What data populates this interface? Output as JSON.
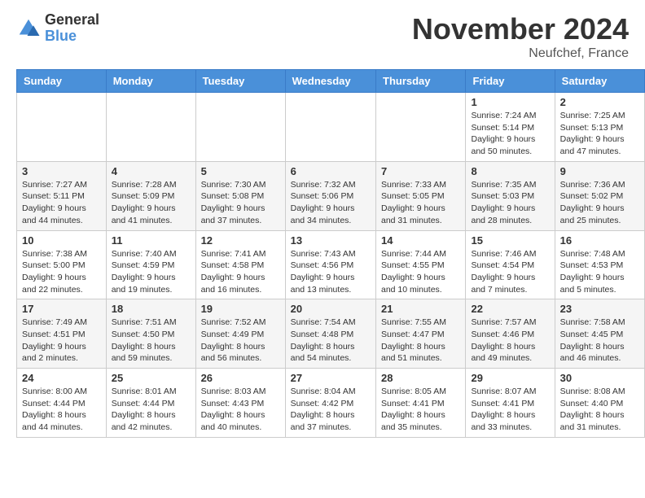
{
  "header": {
    "logo_general": "General",
    "logo_blue": "Blue",
    "month_title": "November 2024",
    "location": "Neufchef, France"
  },
  "days_of_week": [
    "Sunday",
    "Monday",
    "Tuesday",
    "Wednesday",
    "Thursday",
    "Friday",
    "Saturday"
  ],
  "weeks": [
    {
      "days": [
        {
          "num": "",
          "info": ""
        },
        {
          "num": "",
          "info": ""
        },
        {
          "num": "",
          "info": ""
        },
        {
          "num": "",
          "info": ""
        },
        {
          "num": "",
          "info": ""
        },
        {
          "num": "1",
          "info": "Sunrise: 7:24 AM\nSunset: 5:14 PM\nDaylight: 9 hours\nand 50 minutes."
        },
        {
          "num": "2",
          "info": "Sunrise: 7:25 AM\nSunset: 5:13 PM\nDaylight: 9 hours\nand 47 minutes."
        }
      ]
    },
    {
      "days": [
        {
          "num": "3",
          "info": "Sunrise: 7:27 AM\nSunset: 5:11 PM\nDaylight: 9 hours\nand 44 minutes."
        },
        {
          "num": "4",
          "info": "Sunrise: 7:28 AM\nSunset: 5:09 PM\nDaylight: 9 hours\nand 41 minutes."
        },
        {
          "num": "5",
          "info": "Sunrise: 7:30 AM\nSunset: 5:08 PM\nDaylight: 9 hours\nand 37 minutes."
        },
        {
          "num": "6",
          "info": "Sunrise: 7:32 AM\nSunset: 5:06 PM\nDaylight: 9 hours\nand 34 minutes."
        },
        {
          "num": "7",
          "info": "Sunrise: 7:33 AM\nSunset: 5:05 PM\nDaylight: 9 hours\nand 31 minutes."
        },
        {
          "num": "8",
          "info": "Sunrise: 7:35 AM\nSunset: 5:03 PM\nDaylight: 9 hours\nand 28 minutes."
        },
        {
          "num": "9",
          "info": "Sunrise: 7:36 AM\nSunset: 5:02 PM\nDaylight: 9 hours\nand 25 minutes."
        }
      ]
    },
    {
      "days": [
        {
          "num": "10",
          "info": "Sunrise: 7:38 AM\nSunset: 5:00 PM\nDaylight: 9 hours\nand 22 minutes."
        },
        {
          "num": "11",
          "info": "Sunrise: 7:40 AM\nSunset: 4:59 PM\nDaylight: 9 hours\nand 19 minutes."
        },
        {
          "num": "12",
          "info": "Sunrise: 7:41 AM\nSunset: 4:58 PM\nDaylight: 9 hours\nand 16 minutes."
        },
        {
          "num": "13",
          "info": "Sunrise: 7:43 AM\nSunset: 4:56 PM\nDaylight: 9 hours\nand 13 minutes."
        },
        {
          "num": "14",
          "info": "Sunrise: 7:44 AM\nSunset: 4:55 PM\nDaylight: 9 hours\nand 10 minutes."
        },
        {
          "num": "15",
          "info": "Sunrise: 7:46 AM\nSunset: 4:54 PM\nDaylight: 9 hours\nand 7 minutes."
        },
        {
          "num": "16",
          "info": "Sunrise: 7:48 AM\nSunset: 4:53 PM\nDaylight: 9 hours\nand 5 minutes."
        }
      ]
    },
    {
      "days": [
        {
          "num": "17",
          "info": "Sunrise: 7:49 AM\nSunset: 4:51 PM\nDaylight: 9 hours\nand 2 minutes."
        },
        {
          "num": "18",
          "info": "Sunrise: 7:51 AM\nSunset: 4:50 PM\nDaylight: 8 hours\nand 59 minutes."
        },
        {
          "num": "19",
          "info": "Sunrise: 7:52 AM\nSunset: 4:49 PM\nDaylight: 8 hours\nand 56 minutes."
        },
        {
          "num": "20",
          "info": "Sunrise: 7:54 AM\nSunset: 4:48 PM\nDaylight: 8 hours\nand 54 minutes."
        },
        {
          "num": "21",
          "info": "Sunrise: 7:55 AM\nSunset: 4:47 PM\nDaylight: 8 hours\nand 51 minutes."
        },
        {
          "num": "22",
          "info": "Sunrise: 7:57 AM\nSunset: 4:46 PM\nDaylight: 8 hours\nand 49 minutes."
        },
        {
          "num": "23",
          "info": "Sunrise: 7:58 AM\nSunset: 4:45 PM\nDaylight: 8 hours\nand 46 minutes."
        }
      ]
    },
    {
      "days": [
        {
          "num": "24",
          "info": "Sunrise: 8:00 AM\nSunset: 4:44 PM\nDaylight: 8 hours\nand 44 minutes."
        },
        {
          "num": "25",
          "info": "Sunrise: 8:01 AM\nSunset: 4:44 PM\nDaylight: 8 hours\nand 42 minutes."
        },
        {
          "num": "26",
          "info": "Sunrise: 8:03 AM\nSunset: 4:43 PM\nDaylight: 8 hours\nand 40 minutes."
        },
        {
          "num": "27",
          "info": "Sunrise: 8:04 AM\nSunset: 4:42 PM\nDaylight: 8 hours\nand 37 minutes."
        },
        {
          "num": "28",
          "info": "Sunrise: 8:05 AM\nSunset: 4:41 PM\nDaylight: 8 hours\nand 35 minutes."
        },
        {
          "num": "29",
          "info": "Sunrise: 8:07 AM\nSunset: 4:41 PM\nDaylight: 8 hours\nand 33 minutes."
        },
        {
          "num": "30",
          "info": "Sunrise: 8:08 AM\nSunset: 4:40 PM\nDaylight: 8 hours\nand 31 minutes."
        }
      ]
    }
  ]
}
